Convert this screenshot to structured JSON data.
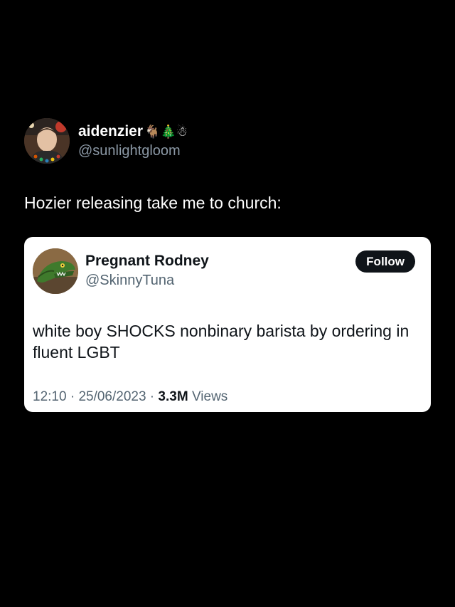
{
  "outer_tweet": {
    "display_name": "aidenzier",
    "name_emojis": "🐐🎄☃",
    "handle": "@sunlightgloom",
    "text": "Hozier releasing take me to church:"
  },
  "quoted_tweet": {
    "display_name": "Pregnant Rodney",
    "handle": "@SkinnyTuna",
    "follow_label": "Follow",
    "text": "white boy SHOCKS nonbinary barista by ordering in fluent LGBT",
    "time": "12:10",
    "separator": " · ",
    "date": "25/06/2023",
    "views_count": "3.3M",
    "views_label": "Views"
  },
  "colors": {
    "background": "#000000",
    "card_background": "#ffffff",
    "secondary_text": "#536471",
    "follow_button": "#0f1419"
  }
}
